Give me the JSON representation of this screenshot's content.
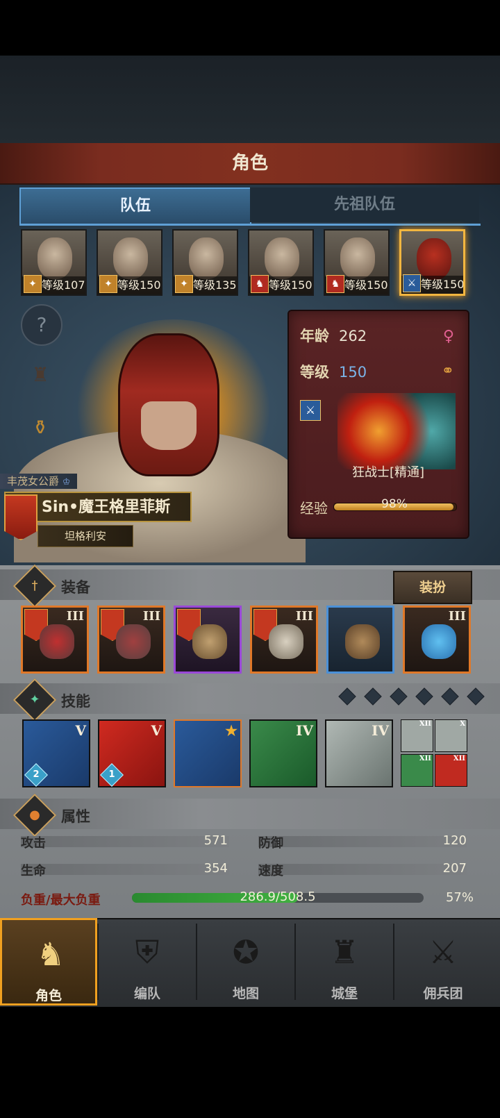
{
  "header": {
    "title": "角色"
  },
  "tabs": [
    {
      "label": "队伍",
      "active": true
    },
    {
      "label": "先祖队伍",
      "active": false
    }
  ],
  "team": [
    {
      "level": "等级107",
      "class_icon": "staff-icon"
    },
    {
      "level": "等级150",
      "class_icon": "staff-icon"
    },
    {
      "level": "等级135",
      "class_icon": "staff-icon"
    },
    {
      "level": "等级150",
      "class_icon": "beast-icon"
    },
    {
      "level": "等级150",
      "class_icon": "beast-icon"
    },
    {
      "level": "等级150",
      "class_icon": "sword-icon",
      "selected": true
    }
  ],
  "hero": {
    "title": "丰茂女公爵",
    "name": "Sin•魔王格里菲斯",
    "origin": "坦格利安"
  },
  "info": {
    "age_label": "年龄",
    "age_value": "262",
    "level_label": "等级",
    "level_value": "150",
    "class_name": "狂战士[精通]",
    "exp_label": "经验",
    "exp_text": "98%",
    "exp_fraction": 0.98
  },
  "equipment": {
    "title": "装备",
    "dress_button": "装扮",
    "items": [
      {
        "tier": "III",
        "rarity": "orange"
      },
      {
        "tier": "III",
        "rarity": "orange"
      },
      {
        "tier": "",
        "rarity": "purple"
      },
      {
        "tier": "III",
        "rarity": "orange"
      },
      {
        "tier": "",
        "rarity": "blue"
      },
      {
        "tier": "III",
        "rarity": "orange"
      }
    ]
  },
  "skills": {
    "title": "技能",
    "items": [
      {
        "tier": "V",
        "count": "2"
      },
      {
        "tier": "V",
        "count": "1"
      },
      {
        "tier": "★",
        "count": ""
      },
      {
        "tier": "IV",
        "count": ""
      },
      {
        "tier": "IV",
        "count": ""
      }
    ],
    "mini": [
      {
        "tier": "XII"
      },
      {
        "tier": "X"
      },
      {
        "tier": "XII"
      },
      {
        "tier": "XII"
      }
    ]
  },
  "attributes": {
    "title": "属性",
    "attack_label": "攻击",
    "attack_value": "571",
    "defense_label": "防御",
    "defense_value": "120",
    "hp_label": "生命",
    "hp_value": "354",
    "speed_label": "速度",
    "speed_value": "207",
    "load_label": "负重/最大负重",
    "load_text": "286.9/508.5",
    "load_pct": "57%",
    "load_fraction": 0.57
  },
  "nav": [
    {
      "label": "角色",
      "active": true
    },
    {
      "label": "编队"
    },
    {
      "label": "地图"
    },
    {
      "label": "城堡"
    },
    {
      "label": "佣兵团"
    }
  ],
  "colors": {
    "accent": "#f0a020",
    "tab_blue": "#5fa0d6",
    "title_red": "#82301f"
  }
}
